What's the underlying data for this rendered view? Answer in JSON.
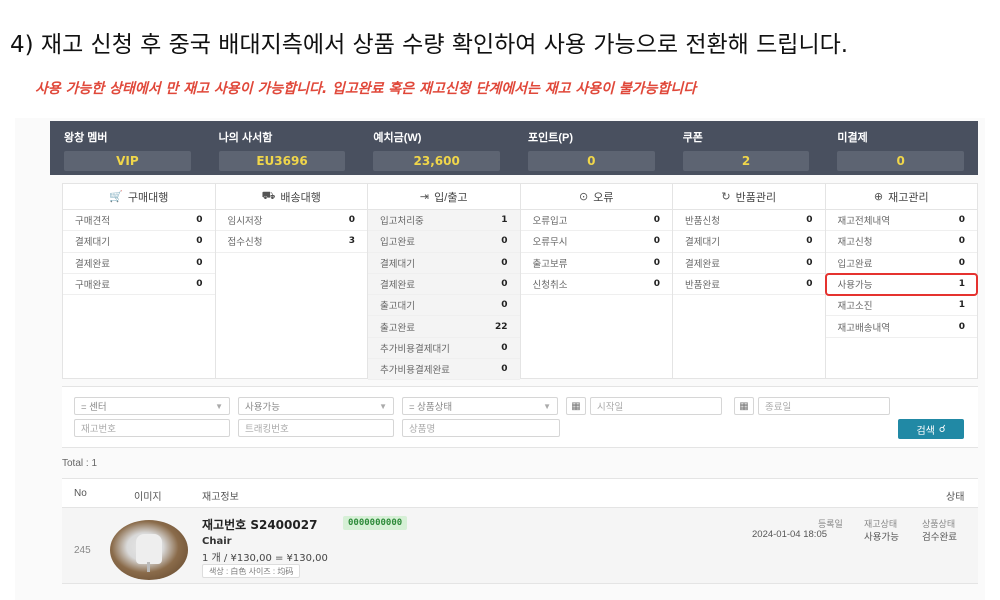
{
  "heading": "4) 재고 신청 후 중국 배대지측에서 상품 수량 확인하여 사용 가능으로 전환해 드립니다.",
  "subheading": "사용 가능한 상태에서 만 재고 사용이 가능합니다. 입고완료 혹은 재고신청 단계에서는 재고 사용이 불가능합니다",
  "stats": [
    {
      "label": "왕창 멤버",
      "value": "VIP"
    },
    {
      "label": "나의 사서함",
      "value": "EU3696"
    },
    {
      "label": "예치금(W)",
      "value": "23,600"
    },
    {
      "label": "포인트(P)",
      "value": "0"
    },
    {
      "label": "쿠폰",
      "value": "2"
    },
    {
      "label": "미결제",
      "value": "0"
    }
  ],
  "columns": [
    {
      "icon": "cart-icon",
      "glyph": "🛒",
      "title": "구매대행",
      "rows": [
        {
          "label": "구매견적",
          "count": "0"
        },
        {
          "label": "결제대기",
          "count": "0"
        },
        {
          "label": "결제완료",
          "count": "0"
        },
        {
          "label": "구매완료",
          "count": "0"
        }
      ]
    },
    {
      "icon": "truck-icon",
      "glyph": "⛟",
      "title": "배송대행",
      "rows": [
        {
          "label": "임시저장",
          "count": "0"
        },
        {
          "label": "접수신청",
          "count": "3"
        }
      ]
    },
    {
      "icon": "inout-icon",
      "glyph": "⇥",
      "title": "입/출고",
      "rows": [
        {
          "label": "입고처리중",
          "count": "1"
        },
        {
          "label": "입고완료",
          "count": "0"
        },
        {
          "label": "결제대기",
          "count": "0"
        },
        {
          "label": "결제완료",
          "count": "0"
        },
        {
          "label": "출고대기",
          "count": "0"
        },
        {
          "label": "출고완료",
          "count": "22"
        },
        {
          "label": "추가비용결제대기",
          "count": "0"
        },
        {
          "label": "추가비용결제완료",
          "count": "0"
        }
      ]
    },
    {
      "icon": "error-icon",
      "glyph": "⊙",
      "title": "오류",
      "rows": [
        {
          "label": "오류입고",
          "count": "0"
        },
        {
          "label": "오류무시",
          "count": "0"
        },
        {
          "label": "출고보류",
          "count": "0"
        },
        {
          "label": "신청취소",
          "count": "0"
        }
      ]
    },
    {
      "icon": "return-icon",
      "glyph": "↻",
      "title": "반품관리",
      "rows": [
        {
          "label": "반품신청",
          "count": "0"
        },
        {
          "label": "결제대기",
          "count": "0"
        },
        {
          "label": "결제완료",
          "count": "0"
        },
        {
          "label": "반품완료",
          "count": "0"
        }
      ]
    },
    {
      "icon": "stock-icon",
      "glyph": "⊕",
      "title": "재고관리",
      "rows": [
        {
          "label": "재고전체내역",
          "count": "0"
        },
        {
          "label": "재고신청",
          "count": "0"
        },
        {
          "label": "입고완료",
          "count": "0"
        },
        {
          "label": "사용가능",
          "count": "1",
          "highlight": true
        },
        {
          "label": "재고소진",
          "count": "1"
        },
        {
          "label": "재고배송내역",
          "count": "0"
        }
      ]
    }
  ],
  "search": {
    "center": "= 센터",
    "status": "사용가능",
    "product_status": "= 상품상태",
    "start_placeholder": "시작일",
    "end_placeholder": "종료일",
    "stock_no_placeholder": "재고번호",
    "tracking_placeholder": "트래킹번호",
    "product_name_placeholder": "상품명",
    "button": "검색"
  },
  "total": "Total : 1",
  "table": {
    "headers": {
      "no": "No",
      "image": "이미지",
      "info": "재고정보",
      "status": "상태"
    },
    "row": {
      "no": "245",
      "stock_id": "재고번호 S2400027",
      "tag": "0000000000",
      "product": "Chair",
      "price": "1 개  /  ¥130,00 = ¥130,00",
      "options": "색상 : 白色   사이즈 : 均码",
      "reg_label": "등록일",
      "reg_date": "2024-01-04 18:05",
      "stock_status_label": "재고상태",
      "stock_status": "사용가능",
      "product_status_label": "상품상태",
      "product_status": "검수완료"
    }
  }
}
